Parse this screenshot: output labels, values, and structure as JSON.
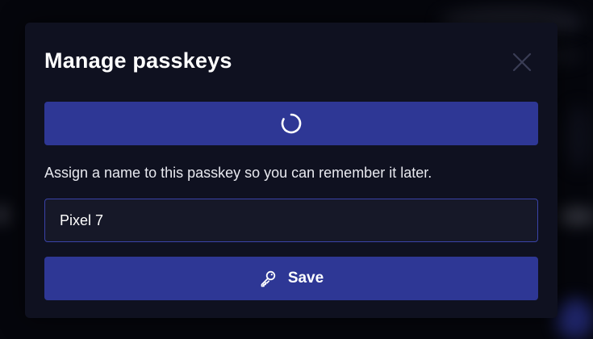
{
  "dialog": {
    "title": "Manage passkeys",
    "close_icon": "close-icon",
    "progress_icon": "loading-spinner-icon",
    "hint": "Assign a name to this passkey so you can remember it later.",
    "name_input": {
      "value": "Pixel 7",
      "placeholder": ""
    },
    "save_button": {
      "label": "Save",
      "icon": "key-icon"
    }
  },
  "colors": {
    "background": "#05060c",
    "dialog": "#0f1120",
    "accent": "#2e3795",
    "input_border": "#3a43a8",
    "text": "#ffffff"
  }
}
